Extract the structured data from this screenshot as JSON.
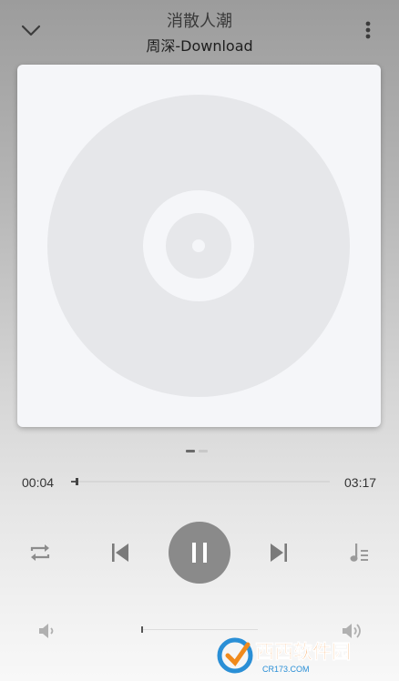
{
  "header": {
    "song_title": "消散人潮",
    "artist_line": "周深-Download",
    "collapse_icon": "chevron-down-icon",
    "more_icon": "more-vertical-icon"
  },
  "album": {
    "placeholder_icon": "vinyl-disc-icon"
  },
  "pager": {
    "current_page": 1,
    "page_count": 2
  },
  "playback": {
    "current_time": "00:04",
    "total_time": "03:17",
    "progress": 0.02
  },
  "controls": {
    "repeat_icon": "repeat-icon",
    "previous_icon": "skip-previous-icon",
    "pause_icon": "pause-icon",
    "next_icon": "skip-next-icon",
    "playlist_icon": "playlist-icon",
    "state": "playing"
  },
  "volume": {
    "low_icon": "volume-low-icon",
    "high_icon": "volume-high-icon",
    "level": 0.0
  },
  "watermark": {
    "text": "西西软件园",
    "subtext": "CR173.COM"
  },
  "colors": {
    "accent": "#8a8a8a",
    "card_bg": "#f5f6f9",
    "disc": "#e6e7ea"
  }
}
